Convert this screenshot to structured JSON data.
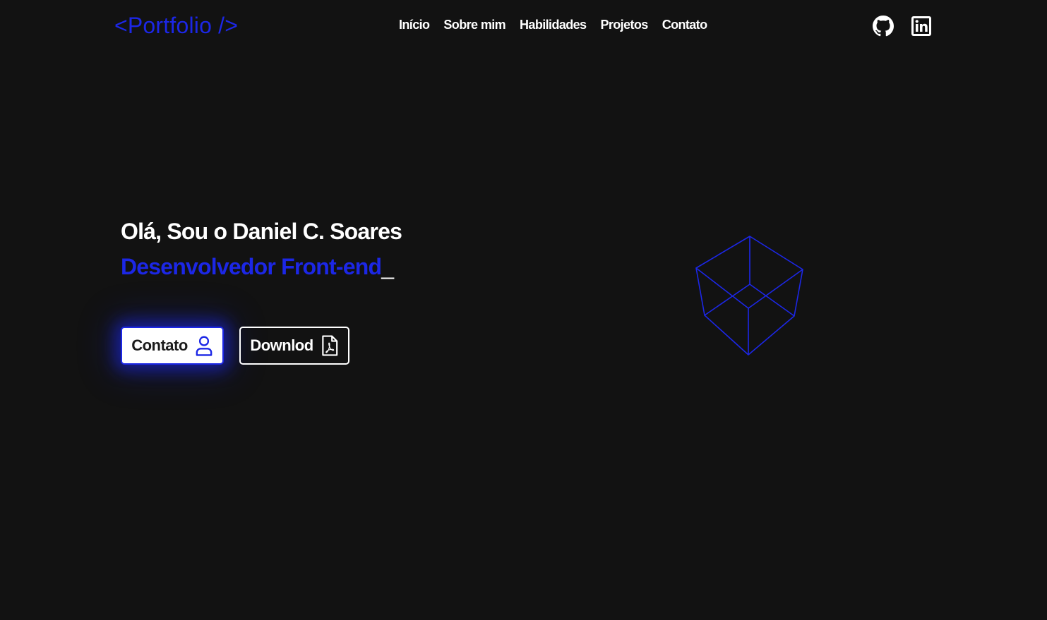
{
  "header": {
    "logo": "<Portfolio />",
    "nav": [
      "Início",
      "Sobre mim",
      "Habilidades",
      "Projetos",
      "Contato"
    ],
    "social_icons": [
      "github-icon",
      "linkedin-icon"
    ]
  },
  "hero": {
    "greeting": "Olá, Sou o Daniel C. Soares",
    "role": "Desenvolvedor Front-end",
    "cursor": "_",
    "buttons": {
      "contact_label": "Contato",
      "contact_icon": "user-icon",
      "download_label": "Downlod",
      "download_icon": "pdf-file-icon"
    },
    "illustration_icon": "wireframe-cube-icon"
  },
  "colors": {
    "background": "#121212",
    "accent": "#1c27e6",
    "text": "#ffffff"
  }
}
